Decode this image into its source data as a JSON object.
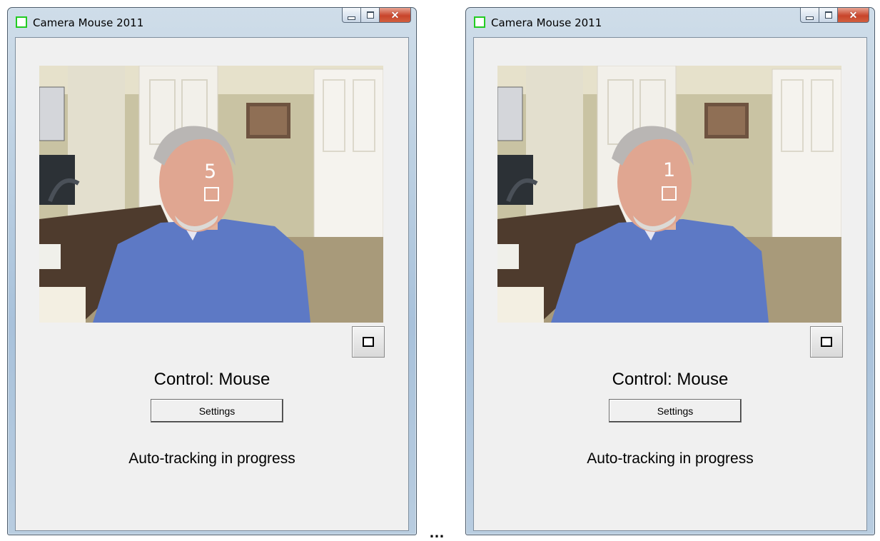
{
  "windows": [
    {
      "title": "Camera Mouse 2011",
      "overlay_number": "5",
      "control_status": "Control: Mouse",
      "settings_label": "Settings",
      "tracking_status": "Auto-tracking in progress"
    },
    {
      "title": "Camera Mouse 2011",
      "overlay_number": "1",
      "control_status": "Control: Mouse",
      "settings_label": "Settings",
      "tracking_status": "Auto-tracking in progress"
    }
  ],
  "separator": "…",
  "icons": {
    "app": "camera-mouse-app-icon",
    "minimize": "minimize-icon",
    "maximize": "maximize-icon",
    "close": "close-icon",
    "select_feature": "select-feature-icon"
  },
  "colors": {
    "app_icon": "#22cc22",
    "window_frame": "#bcd0e2",
    "client_bg": "#f0f0f0",
    "close_button": "#c8452b"
  }
}
